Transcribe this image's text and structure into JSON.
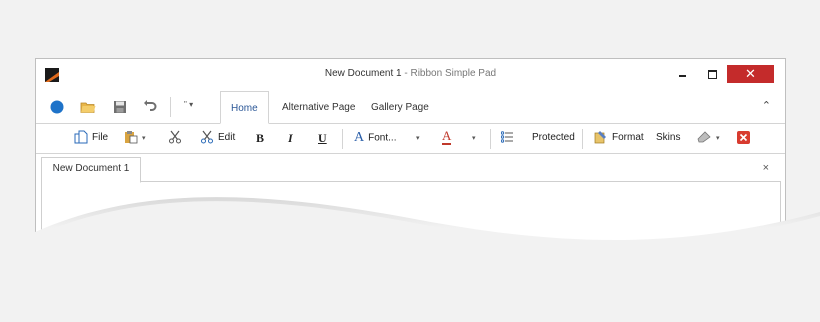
{
  "window": {
    "title": "New Document 1",
    "title_suffix": " - Ribbon Simple Pad",
    "close_glyph": "✕"
  },
  "qat": {
    "icons": [
      "app-menu-icon",
      "open-folder-icon",
      "save-icon",
      "undo-icon",
      "quick-access-dropdown-icon"
    ],
    "overflow_label": "\" ▾"
  },
  "tabs": [
    {
      "label": "Home",
      "active": true
    },
    {
      "label": "Alternative Page",
      "active": false
    },
    {
      "label": "Gallery Page",
      "active": false
    }
  ],
  "ribbon": {
    "file_label": "File",
    "edit_label": "Edit",
    "bold_label": "B",
    "italic_label": "I",
    "underline_label": "U",
    "font_label": "Font...",
    "font_color_label": "A",
    "protected_label": "Protected",
    "format_label": "Format",
    "skins_label": "Skins"
  },
  "document": {
    "tab_label": "New Document 1",
    "close_glyph": "×"
  },
  "colors": {
    "close_button": "#c42b2b",
    "active_tab_text": "#2b5797",
    "app_orb": "#1e73c9",
    "font_color_underline": "#c0392b"
  }
}
